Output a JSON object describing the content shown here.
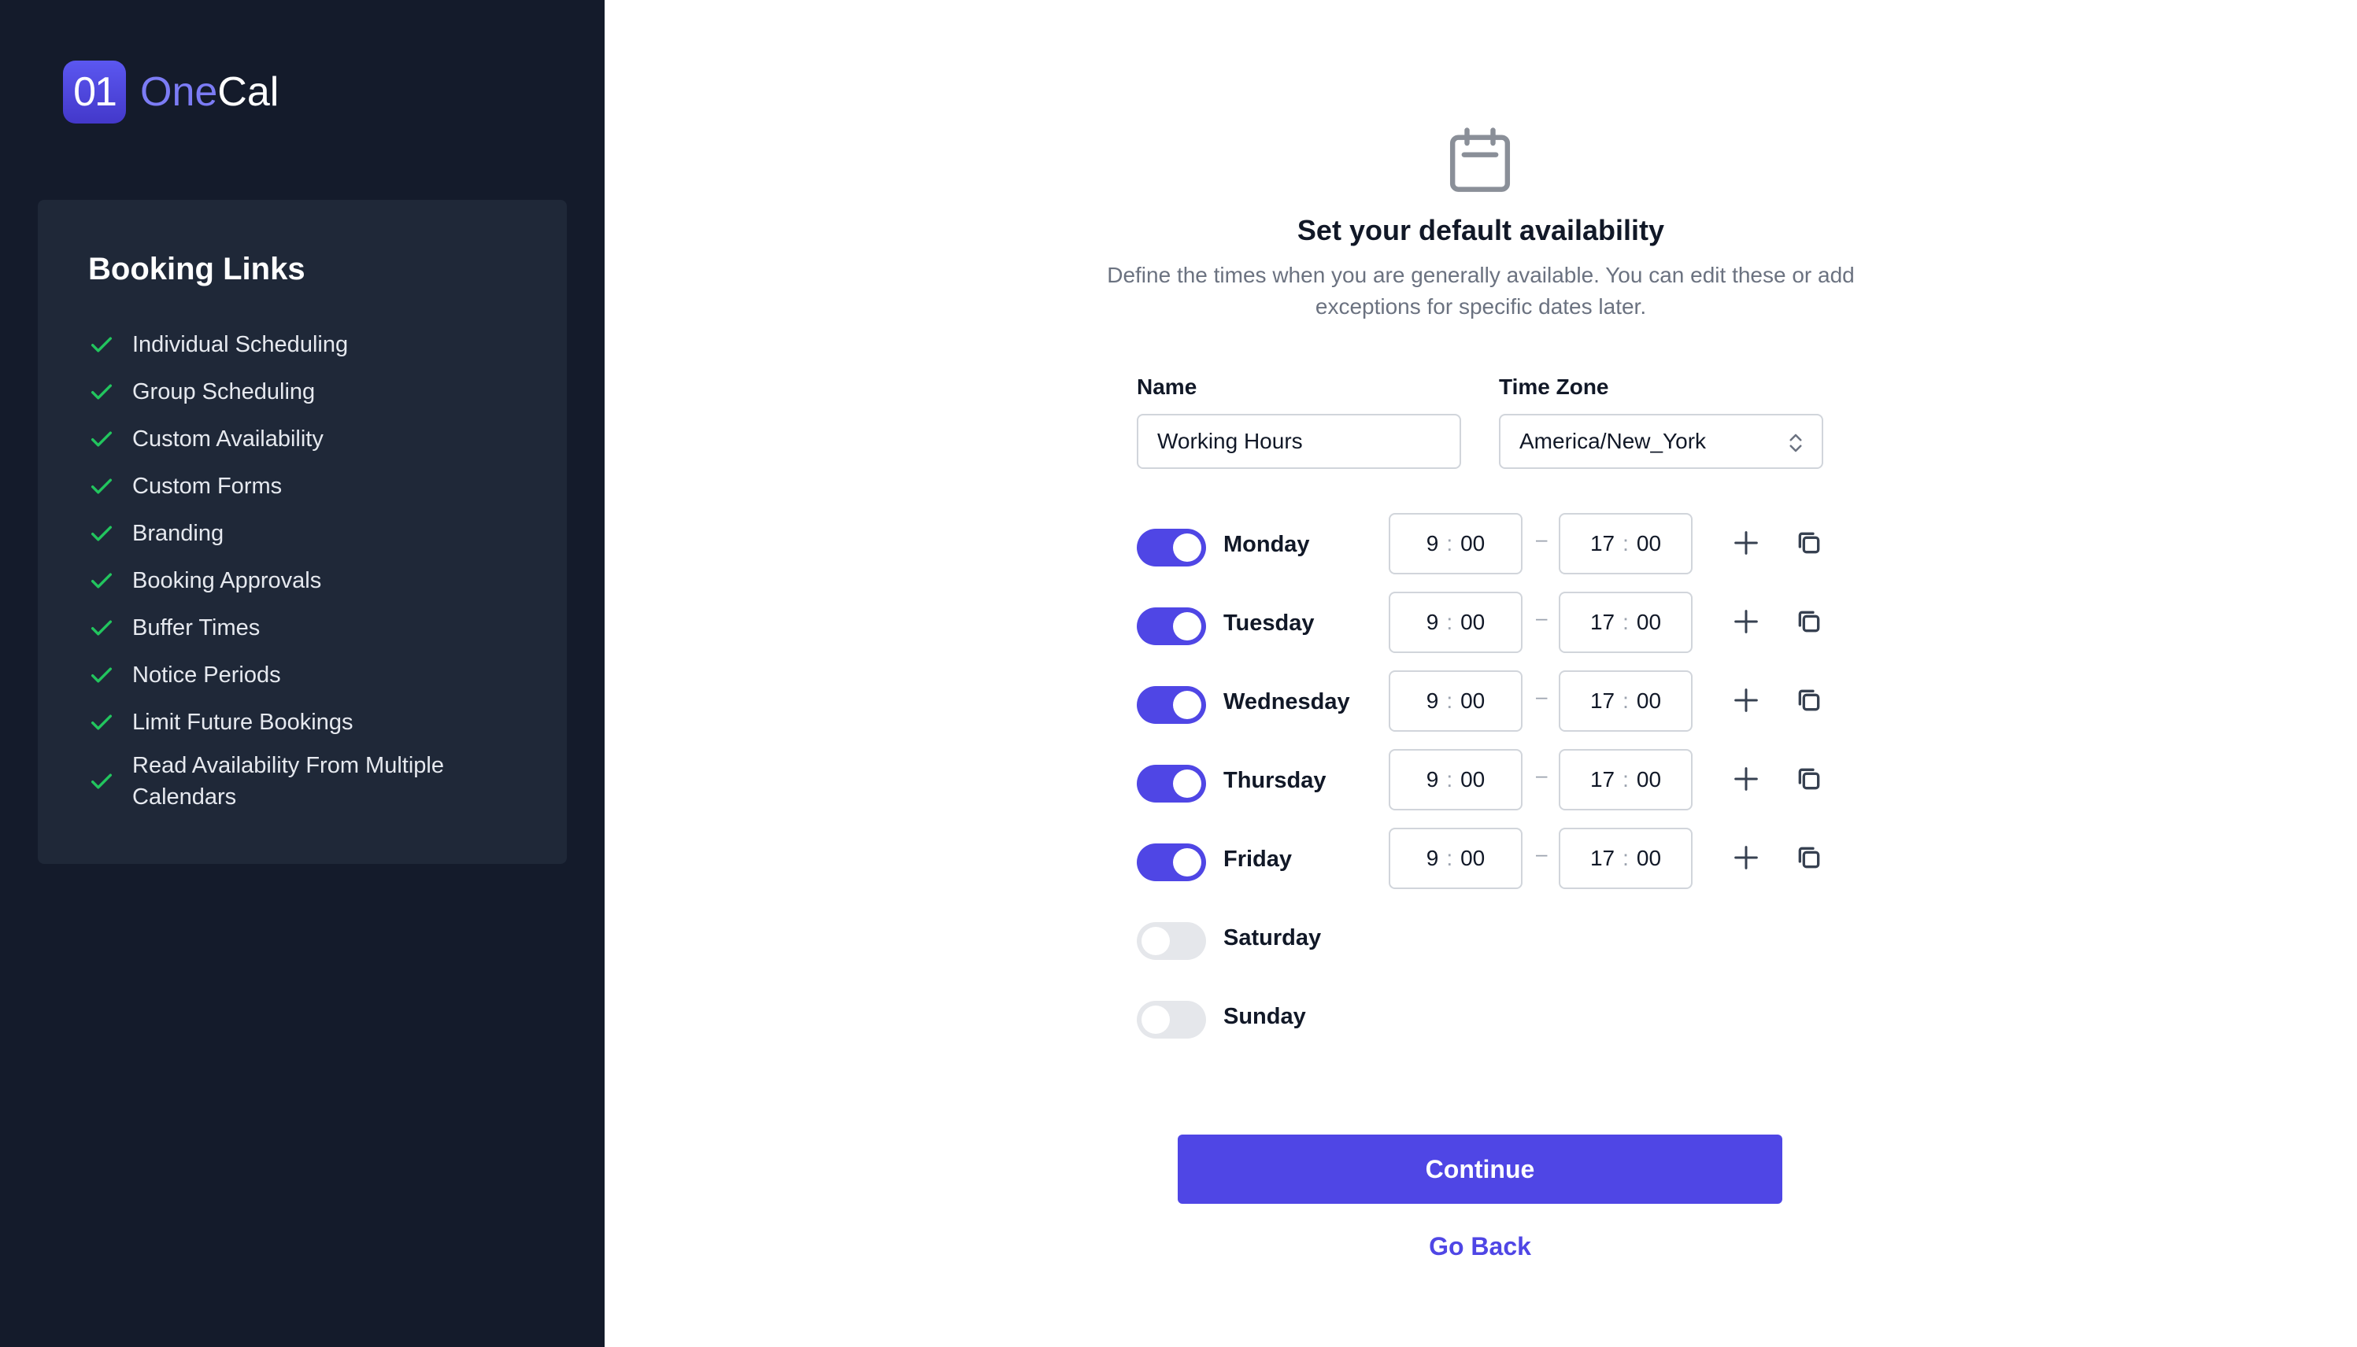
{
  "brand": {
    "mark": "01",
    "name_part1": "One",
    "name_part2": "Cal"
  },
  "sidebar": {
    "card_title": "Booking Links",
    "features": [
      "Individual Scheduling",
      "Group Scheduling",
      "Custom Availability",
      "Custom Forms",
      "Branding",
      "Booking Approvals",
      "Buffer Times",
      "Notice Periods",
      "Limit Future Bookings",
      "Read Availability From Multiple Calendars"
    ],
    "check_color": "#22c55e"
  },
  "main": {
    "icon": "calendar-icon",
    "title": "Set your default availability",
    "subtitle_line1": "Define the times when you are generally available. You can edit these or add",
    "subtitle_line2": "exceptions for specific dates later.",
    "name_label": "Name",
    "name_value": "Working Hours",
    "timezone_label": "Time Zone",
    "timezone_value": "America/New_York",
    "days": [
      {
        "name": "Monday",
        "enabled": true,
        "start_h": "9",
        "start_m": "00",
        "end_h": "17",
        "end_m": "00"
      },
      {
        "name": "Tuesday",
        "enabled": true,
        "start_h": "9",
        "start_m": "00",
        "end_h": "17",
        "end_m": "00"
      },
      {
        "name": "Wednesday",
        "enabled": true,
        "start_h": "9",
        "start_m": "00",
        "end_h": "17",
        "end_m": "00"
      },
      {
        "name": "Thursday",
        "enabled": true,
        "start_h": "9",
        "start_m": "00",
        "end_h": "17",
        "end_m": "00"
      },
      {
        "name": "Friday",
        "enabled": true,
        "start_h": "9",
        "start_m": "00",
        "end_h": "17",
        "end_m": "00"
      },
      {
        "name": "Saturday",
        "enabled": false
      },
      {
        "name": "Sunday",
        "enabled": false
      }
    ],
    "time_separator": ":",
    "range_separator": "–",
    "continue_label": "Continue",
    "goback_label": "Go Back"
  },
  "colors": {
    "accent": "#4f46e5",
    "sidebar_bg": "#141b2b",
    "card_bg": "#1f2838"
  }
}
